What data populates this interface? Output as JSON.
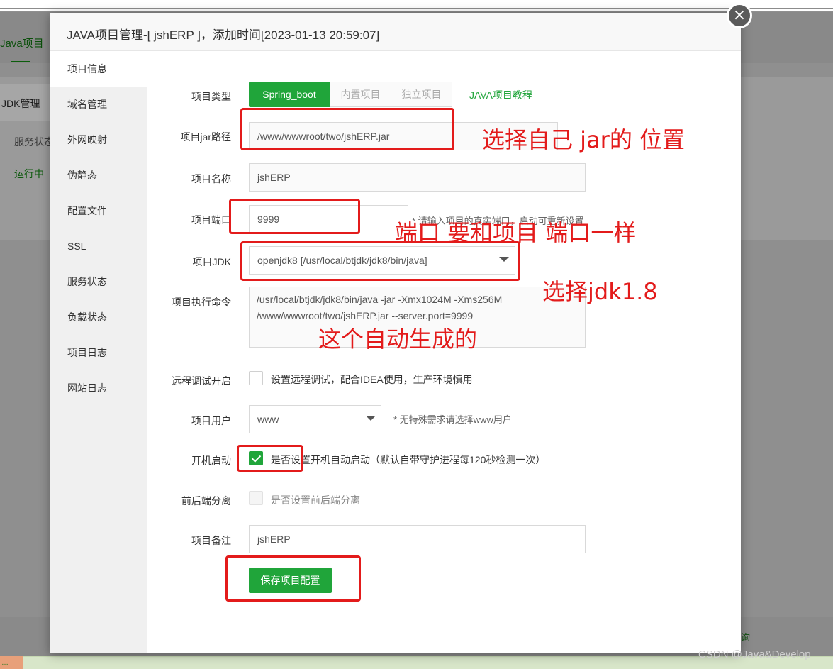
{
  "background": {
    "tab": "Java项目",
    "jdk_menu": "JDK管理",
    "service_status": "服务状态",
    "running": "运行中",
    "bottom_text": "询"
  },
  "modal": {
    "title": "JAVA项目管理-[ jshERP ]，添加时间[2023-01-13 20:59:07]",
    "close_icon": "close-icon"
  },
  "sidebar": {
    "items": [
      {
        "label": "项目信息",
        "active": true
      },
      {
        "label": "域名管理"
      },
      {
        "label": "外网映射"
      },
      {
        "label": "伪静态"
      },
      {
        "label": "配置文件"
      },
      {
        "label": "SSL"
      },
      {
        "label": "服务状态"
      },
      {
        "label": "负载状态"
      },
      {
        "label": "项目日志"
      },
      {
        "label": "网站日志"
      }
    ]
  },
  "form": {
    "project_type": {
      "label": "项目类型",
      "options": [
        "Spring_boot",
        "内置项目",
        "独立项目"
      ],
      "selected": "Spring_boot",
      "tutorial_link": "JAVA项目教程"
    },
    "jar_path": {
      "label": "项目jar路径",
      "value": "/www/wwwroot/two/jshERP.jar"
    },
    "project_name": {
      "label": "项目名称",
      "value": "jshERP"
    },
    "port": {
      "label": "项目端口",
      "value": "9999",
      "hint": "* 请输入项目的真实端口，启动可重新设置"
    },
    "jdk": {
      "label": "项目JDK",
      "value": "openjdk8 [/usr/local/btjdk/jdk8/bin/java]"
    },
    "command": {
      "label": "项目执行命令",
      "line1": "/usr/local/btjdk/jdk8/bin/java -jar -Xmx1024M -Xms256M",
      "line2": "/www/wwwroot/two/jshERP.jar --server.port=9999"
    },
    "remote_debug": {
      "label": "远程调试开启",
      "text": "设置远程调试，配合IDEA使用，生产环境慎用",
      "checked": false
    },
    "user": {
      "label": "项目用户",
      "value": "www",
      "hint": "* 无特殊需求请选择www用户"
    },
    "autostart": {
      "label": "开机启动",
      "text": "是否设置开机自动启动（默认自带守护进程每120秒检测一次）",
      "checked": true
    },
    "frontend_sep": {
      "label": "前后端分离",
      "text": "是否设置前后端分离",
      "checked": false
    },
    "remark": {
      "label": "项目备注",
      "value": "jshERP"
    },
    "save_button": "保存项目配置"
  },
  "annotations": {
    "jar_note": "选择自己 jar的 位置",
    "port_note": "端口 要和项目 端口一样",
    "jdk_note": "选择jdk1.8",
    "command_note": "这个自动生成的",
    "annotation_color": "#e31b1b"
  },
  "watermark": "CSDN @Java&Develop",
  "colors": {
    "primary": "#20a53a",
    "annotation": "#e31b1b"
  }
}
